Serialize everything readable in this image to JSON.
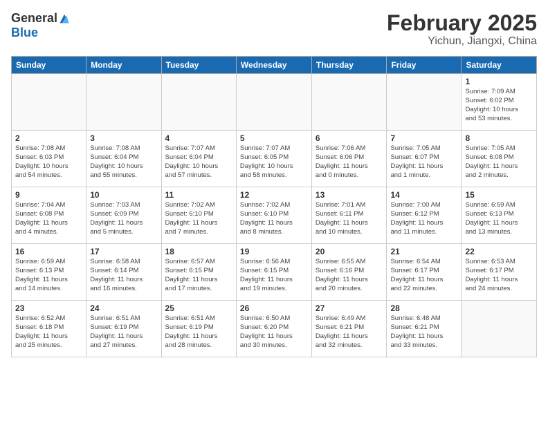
{
  "header": {
    "logo_general": "General",
    "logo_blue": "Blue",
    "month_title": "February 2025",
    "location": "Yichun, Jiangxi, China"
  },
  "days_of_week": [
    "Sunday",
    "Monday",
    "Tuesday",
    "Wednesday",
    "Thursday",
    "Friday",
    "Saturday"
  ],
  "weeks": [
    [
      {
        "day": "",
        "info": ""
      },
      {
        "day": "",
        "info": ""
      },
      {
        "day": "",
        "info": ""
      },
      {
        "day": "",
        "info": ""
      },
      {
        "day": "",
        "info": ""
      },
      {
        "day": "",
        "info": ""
      },
      {
        "day": "1",
        "info": "Sunrise: 7:09 AM\nSunset: 6:02 PM\nDaylight: 10 hours\nand 53 minutes."
      }
    ],
    [
      {
        "day": "2",
        "info": "Sunrise: 7:08 AM\nSunset: 6:03 PM\nDaylight: 10 hours\nand 54 minutes."
      },
      {
        "day": "3",
        "info": "Sunrise: 7:08 AM\nSunset: 6:04 PM\nDaylight: 10 hours\nand 55 minutes."
      },
      {
        "day": "4",
        "info": "Sunrise: 7:07 AM\nSunset: 6:04 PM\nDaylight: 10 hours\nand 57 minutes."
      },
      {
        "day": "5",
        "info": "Sunrise: 7:07 AM\nSunset: 6:05 PM\nDaylight: 10 hours\nand 58 minutes."
      },
      {
        "day": "6",
        "info": "Sunrise: 7:06 AM\nSunset: 6:06 PM\nDaylight: 11 hours\nand 0 minutes."
      },
      {
        "day": "7",
        "info": "Sunrise: 7:05 AM\nSunset: 6:07 PM\nDaylight: 11 hours\nand 1 minute."
      },
      {
        "day": "8",
        "info": "Sunrise: 7:05 AM\nSunset: 6:08 PM\nDaylight: 11 hours\nand 2 minutes."
      }
    ],
    [
      {
        "day": "9",
        "info": "Sunrise: 7:04 AM\nSunset: 6:08 PM\nDaylight: 11 hours\nand 4 minutes."
      },
      {
        "day": "10",
        "info": "Sunrise: 7:03 AM\nSunset: 6:09 PM\nDaylight: 11 hours\nand 5 minutes."
      },
      {
        "day": "11",
        "info": "Sunrise: 7:02 AM\nSunset: 6:10 PM\nDaylight: 11 hours\nand 7 minutes."
      },
      {
        "day": "12",
        "info": "Sunrise: 7:02 AM\nSunset: 6:10 PM\nDaylight: 11 hours\nand 8 minutes."
      },
      {
        "day": "13",
        "info": "Sunrise: 7:01 AM\nSunset: 6:11 PM\nDaylight: 11 hours\nand 10 minutes."
      },
      {
        "day": "14",
        "info": "Sunrise: 7:00 AM\nSunset: 6:12 PM\nDaylight: 11 hours\nand 11 minutes."
      },
      {
        "day": "15",
        "info": "Sunrise: 6:59 AM\nSunset: 6:13 PM\nDaylight: 11 hours\nand 13 minutes."
      }
    ],
    [
      {
        "day": "16",
        "info": "Sunrise: 6:59 AM\nSunset: 6:13 PM\nDaylight: 11 hours\nand 14 minutes."
      },
      {
        "day": "17",
        "info": "Sunrise: 6:58 AM\nSunset: 6:14 PM\nDaylight: 11 hours\nand 16 minutes."
      },
      {
        "day": "18",
        "info": "Sunrise: 6:57 AM\nSunset: 6:15 PM\nDaylight: 11 hours\nand 17 minutes."
      },
      {
        "day": "19",
        "info": "Sunrise: 6:56 AM\nSunset: 6:15 PM\nDaylight: 11 hours\nand 19 minutes."
      },
      {
        "day": "20",
        "info": "Sunrise: 6:55 AM\nSunset: 6:16 PM\nDaylight: 11 hours\nand 20 minutes."
      },
      {
        "day": "21",
        "info": "Sunrise: 6:54 AM\nSunset: 6:17 PM\nDaylight: 11 hours\nand 22 minutes."
      },
      {
        "day": "22",
        "info": "Sunrise: 6:53 AM\nSunset: 6:17 PM\nDaylight: 11 hours\nand 24 minutes."
      }
    ],
    [
      {
        "day": "23",
        "info": "Sunrise: 6:52 AM\nSunset: 6:18 PM\nDaylight: 11 hours\nand 25 minutes."
      },
      {
        "day": "24",
        "info": "Sunrise: 6:51 AM\nSunset: 6:19 PM\nDaylight: 11 hours\nand 27 minutes."
      },
      {
        "day": "25",
        "info": "Sunrise: 6:51 AM\nSunset: 6:19 PM\nDaylight: 11 hours\nand 28 minutes."
      },
      {
        "day": "26",
        "info": "Sunrise: 6:50 AM\nSunset: 6:20 PM\nDaylight: 11 hours\nand 30 minutes."
      },
      {
        "day": "27",
        "info": "Sunrise: 6:49 AM\nSunset: 6:21 PM\nDaylight: 11 hours\nand 32 minutes."
      },
      {
        "day": "28",
        "info": "Sunrise: 6:48 AM\nSunset: 6:21 PM\nDaylight: 11 hours\nand 33 minutes."
      },
      {
        "day": "",
        "info": ""
      }
    ]
  ]
}
